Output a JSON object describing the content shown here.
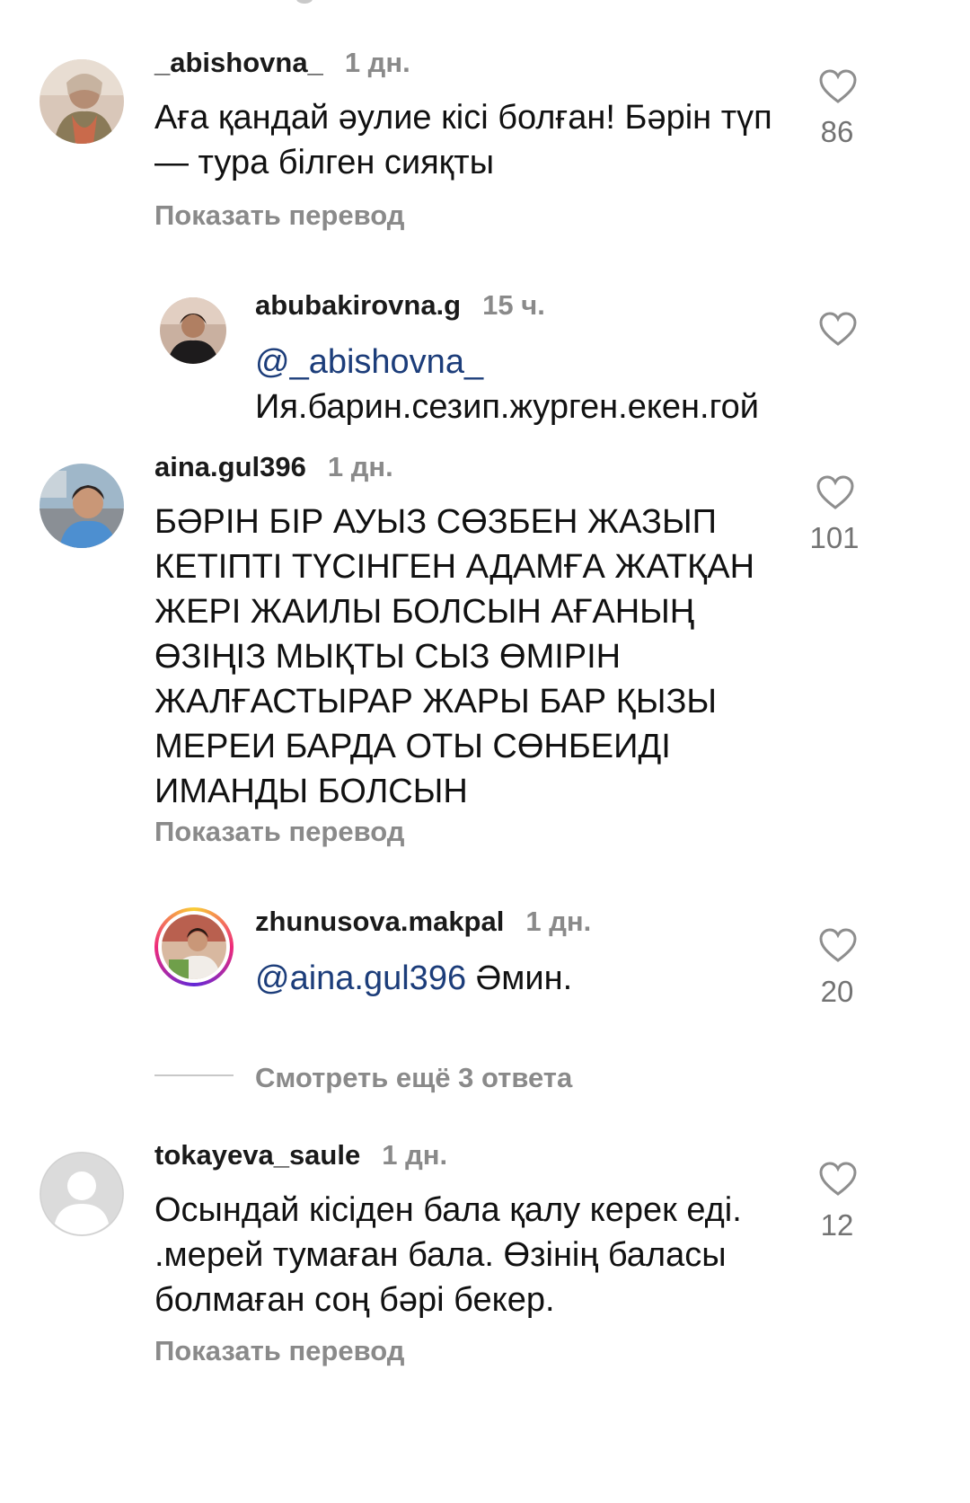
{
  "comments": [
    {
      "username": "_abishovna_",
      "time": "1 дн.",
      "text": "Аға қандай  әулие кісі болған!  Бәрін түп — тура білген  сияқты",
      "translate_label": "Показать перевод",
      "likes": "86"
    },
    {
      "username": "abubakirovna.g",
      "time": "15 ч.",
      "mention": "@_abishovna_",
      "text": " Ия.барин.сезип.журген.екен.гой"
    },
    {
      "username": "aina.gul396",
      "time": "1 дн.",
      "text": "БӘРІН БІР АУЫЗ СӨЗБЕН ЖАЗЫП КЕТІПТІ ТҮСІНГЕН АДАМҒА ЖАТҚАН ЖЕРІ ЖАИЛЫ БОЛСЫН АҒАНЫҢ  ӨЗІҢІЗ МЫҚТЫ СЫЗ ӨМІРІН ЖАЛҒАСТЫРАР ЖАРЫ БАР ҚЫЗЫ МЕРЕИ БАРДА ОТЫ СӨНБЕИДІ ИМАНДЫ БОЛСЫН",
      "translate_label": "Показать перевод",
      "likes": "101"
    },
    {
      "username": "zhunusova.makpal",
      "time": "1 дн.",
      "mention": "@aina.gul396",
      "text": " Әмин.",
      "likes": "20"
    },
    {
      "username": "tokayeva_saule",
      "time": "1 дн.",
      "text": "Осындай кісіден бала қалу керек еді. .мерей тумаған бала. Өзінің баласы болмаған соң бәрі бекер.",
      "translate_label": "Показать перевод",
      "likes": "12"
    }
  ],
  "view_more_replies": "Смотреть ещё 3 ответа",
  "icons": {
    "like": "heart-outline-icon",
    "avatar_placeholder": "default-avatar-icon"
  },
  "colors": {
    "username": "#1a1a1a",
    "secondary": "#8a8a8a",
    "mention": "#1c3d7a",
    "story_ring_start": "#f9ce34",
    "story_ring_mid": "#ee2a7b",
    "story_ring_end": "#6228d7"
  }
}
